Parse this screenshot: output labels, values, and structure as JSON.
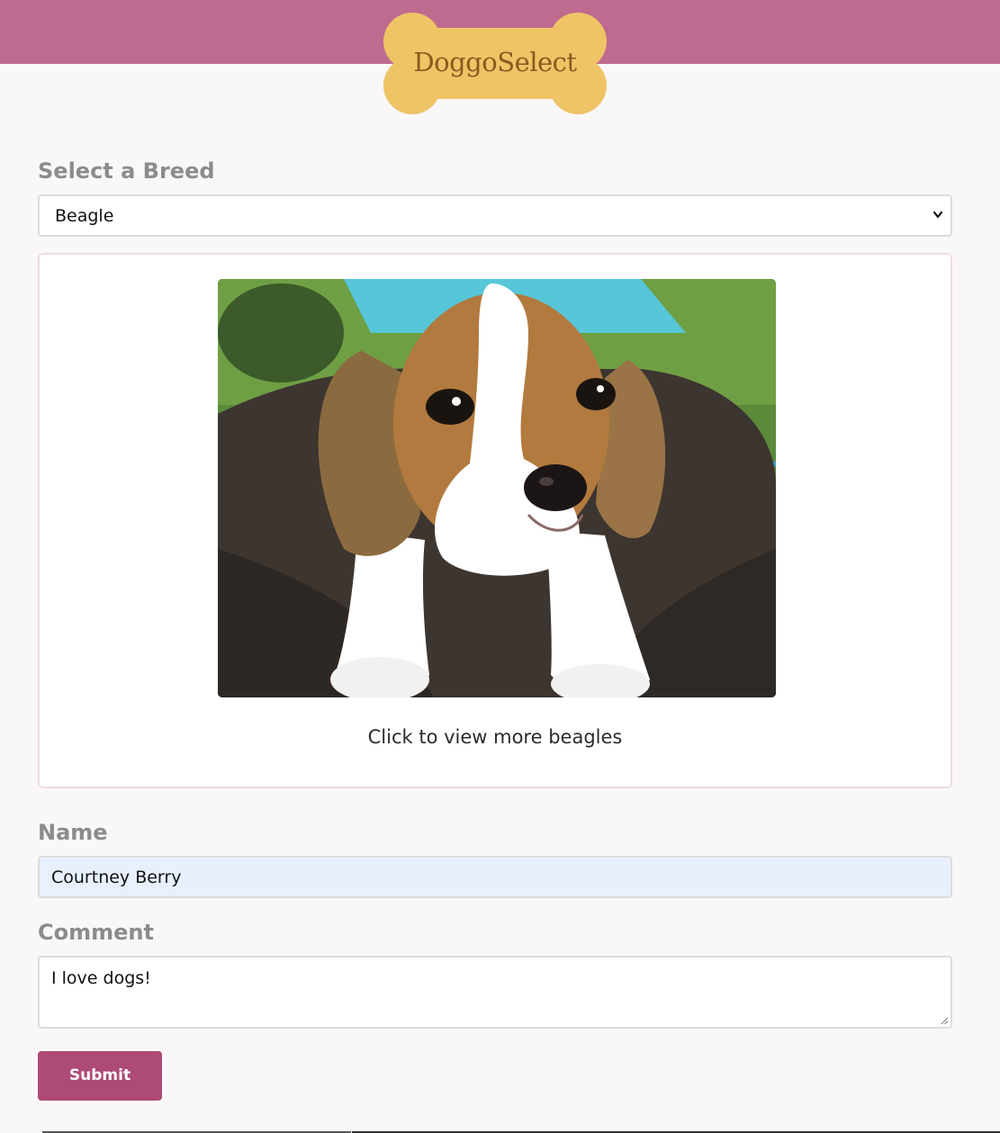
{
  "header": {
    "logo_text": "DoggoSelect",
    "bar_color": "#bf6a8f",
    "bone_color": "#eec466"
  },
  "breed": {
    "label": "Select a Breed",
    "selected": "Beagle"
  },
  "gallery": {
    "image_subject": "beagle puppy",
    "caption": "Click to view more beagles"
  },
  "form": {
    "name_label": "Name",
    "name_value": "Courtney Berry",
    "comment_label": "Comment",
    "comment_value": "I love dogs!",
    "submit_label": "Submit",
    "submit_color": "#ad4a76"
  }
}
